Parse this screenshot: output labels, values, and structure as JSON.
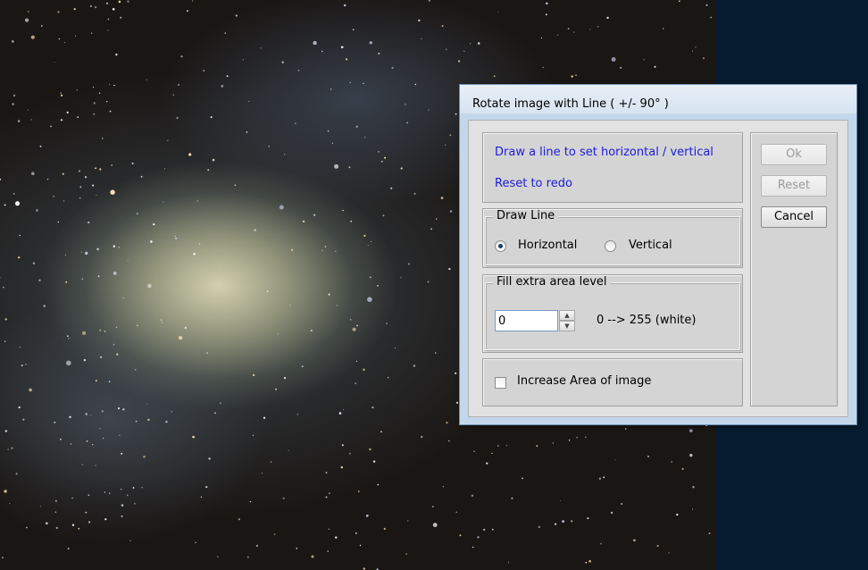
{
  "dialog": {
    "title": "Rotate image with Line  ( +/- 90° )",
    "instructions": {
      "line1": "Draw a line to set horizontal / vertical",
      "line2": "Reset to redo"
    },
    "draw_line": {
      "legend": "Draw Line",
      "options": [
        {
          "label": "Horizontal",
          "selected": true
        },
        {
          "label": "Vertical",
          "selected": false
        }
      ]
    },
    "fill_level": {
      "legend": "Fill extra area level",
      "value": "0",
      "range_label": "0  -->  255 (white)"
    },
    "increase_area": {
      "label": "Increase Area of image",
      "checked": false
    },
    "buttons": {
      "ok": "Ok",
      "reset": "Reset",
      "cancel": "Cancel"
    }
  },
  "icons": {
    "spin_up": "spin-up-arrow-icon",
    "spin_down": "spin-down-arrow-icon"
  },
  "colors": {
    "link_text": "#1c1cd6",
    "dialog_frame": "#c3d7ec",
    "background_right": "#061a30"
  }
}
